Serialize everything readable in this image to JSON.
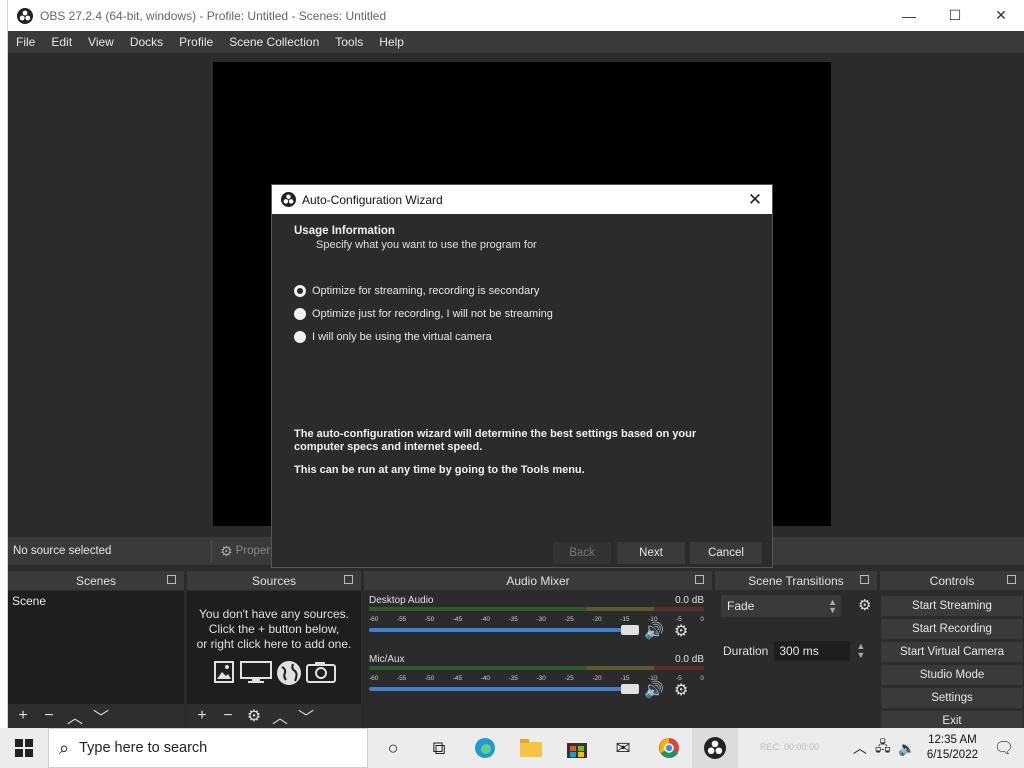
{
  "window": {
    "title": "OBS 27.2.4 (64-bit, windows) - Profile: Untitled - Scenes: Untitled",
    "minimize": "—",
    "maximize": "☐",
    "close": "✕"
  },
  "menu": [
    "File",
    "Edit",
    "View",
    "Docks",
    "Profile",
    "Scene Collection",
    "Tools",
    "Help"
  ],
  "status": {
    "no_source": "No source selected",
    "properties": "Propert"
  },
  "docks": {
    "scenes": {
      "title": "Scenes",
      "items": [
        "Scene"
      ]
    },
    "sources": {
      "title": "Sources",
      "empty_line1": "You don't have any sources.",
      "empty_line2": "Click the + button below,",
      "empty_line3": "or right click here to add one."
    },
    "mixer": {
      "title": "Audio Mixer",
      "channels": [
        {
          "name": "Desktop Audio",
          "db": "0.0 dB",
          "volume_percent": 100
        },
        {
          "name": "Mic/Aux",
          "db": "0.0 dB",
          "volume_percent": 100
        }
      ],
      "ticks": [
        "-60",
        "-55",
        "-50",
        "-45",
        "-40",
        "-35",
        "-30",
        "-25",
        "-20",
        "-15",
        "-10",
        "-5",
        "0"
      ]
    },
    "transitions": {
      "title": "Scene Transitions",
      "selected": "Fade",
      "duration_label": "Duration",
      "duration_value": "300 ms"
    },
    "controls": {
      "title": "Controls",
      "buttons": [
        "Start Streaming",
        "Start Recording",
        "Start Virtual Camera",
        "Studio Mode",
        "Settings",
        "Exit"
      ]
    }
  },
  "dialog": {
    "title": "Auto-Configuration Wizard",
    "heading": "Usage Information",
    "subheading": "Specify what you want to use the program for",
    "options": [
      {
        "label": "Optimize for streaming, recording is secondary",
        "checked": true
      },
      {
        "label": "Optimize just for recording, I will not be streaming",
        "checked": false
      },
      {
        "label": "I will only be using the virtual camera",
        "checked": false
      }
    ],
    "info1": "The auto-configuration wizard will determine the best settings based on your computer specs and internet speed.",
    "info2": "This can be run at any time by going to the Tools menu.",
    "back": "Back",
    "next": "Next",
    "cancel": "Cancel"
  },
  "taskbar": {
    "search_placeholder": "Type here to search",
    "time": "12:35 AM",
    "date": "6/15/2022",
    "faint_rec": "REC: 00:00:00"
  },
  "colors": {
    "obs_dark": "#2b2b2b",
    "panel": "#3a3a3a",
    "fader_blue": "#3e7fcf"
  }
}
